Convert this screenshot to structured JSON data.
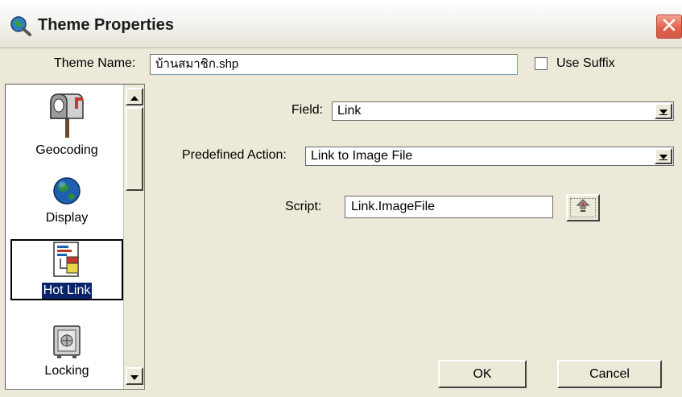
{
  "window": {
    "title": "Theme Properties",
    "icon": "globe-magnifier-icon",
    "close_icon": "close-icon"
  },
  "theme": {
    "name_label": "Theme Name:",
    "name_value": "บ้านสมาชิก.shp",
    "use_suffix_label": "Use Suffix",
    "use_suffix_checked": false
  },
  "sidebar": {
    "items": [
      {
        "label": "Geocoding",
        "icon": "mailbox-icon",
        "selected": false
      },
      {
        "label": "Display",
        "icon": "globe-icon",
        "selected": false
      },
      {
        "label": "Hot Link",
        "icon": "hot-link-icon",
        "selected": true
      },
      {
        "label": "Locking",
        "icon": "safe-lock-icon",
        "selected": false
      }
    ]
  },
  "form": {
    "field_label": "Field:",
    "field_value": "Link",
    "action_label": "Predefined Action:",
    "action_value": "Link to Image File",
    "script_label": "Script:",
    "script_value": "Link.ImageFile",
    "script_button_icon": "script-browse-icon"
  },
  "buttons": {
    "ok_label": "OK",
    "cancel_label": "Cancel"
  },
  "colors": {
    "dialog_bg": "#ece9d8",
    "selection": "#0a246a",
    "close_button": "#e0604a"
  }
}
